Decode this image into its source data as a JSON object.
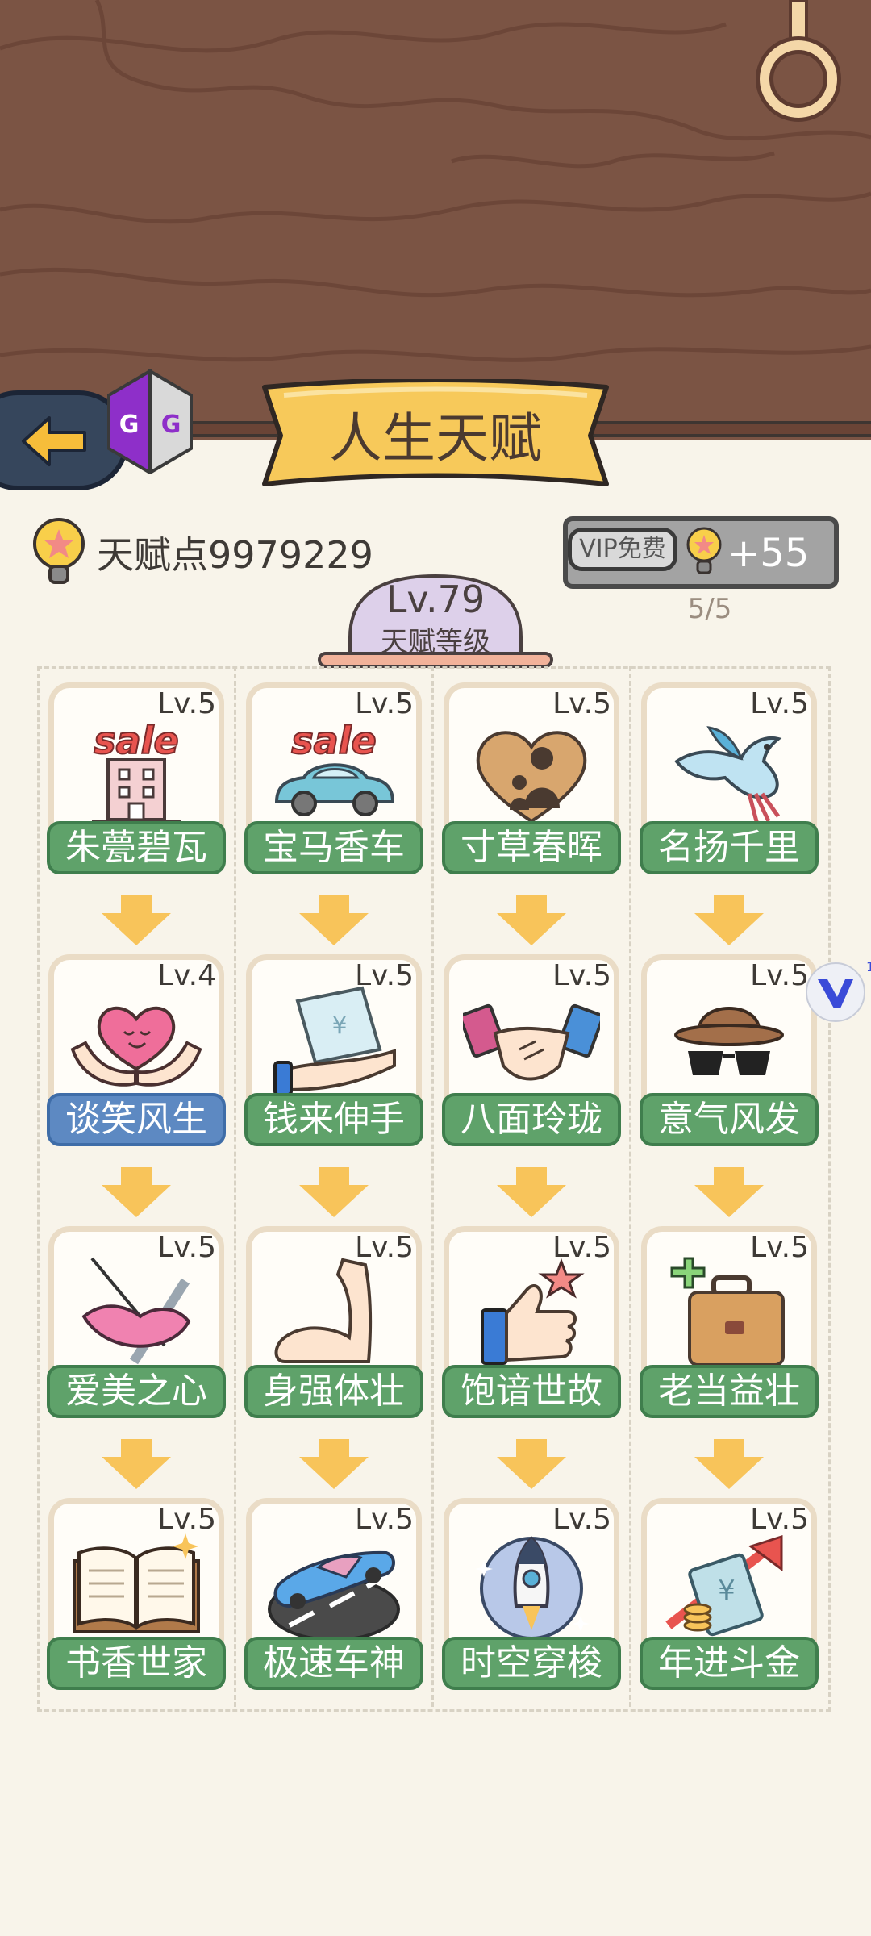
{
  "title": "人生天赋",
  "badge": "GG",
  "talent_points": "天赋点9979229",
  "vip": {
    "tag": "VIP免费",
    "bonus": "+55",
    "count": "5/5"
  },
  "level": {
    "value": "Lv.79",
    "label": "天赋等级"
  },
  "talents": [
    {
      "lv": "Lv.5",
      "name": "朱甍碧瓦",
      "icon": "building-sale-icon",
      "color": "green"
    },
    {
      "lv": "Lv.5",
      "name": "宝马香车",
      "icon": "car-sale-icon",
      "color": "green"
    },
    {
      "lv": "Lv.5",
      "name": "寸草春晖",
      "icon": "heart-family-icon",
      "color": "green"
    },
    {
      "lv": "Lv.5",
      "name": "名扬千里",
      "icon": "bird-icon",
      "color": "green"
    },
    {
      "lv": "Lv.4",
      "name": "谈笑风生",
      "icon": "heart-hands-icon",
      "color": "blue"
    },
    {
      "lv": "Lv.5",
      "name": "钱来伸手",
      "icon": "money-hand-icon",
      "color": "green"
    },
    {
      "lv": "Lv.5",
      "name": "八面玲珑",
      "icon": "handshake-icon",
      "color": "green"
    },
    {
      "lv": "Lv.5",
      "name": "意气风发",
      "icon": "hat-glasses-icon",
      "color": "green"
    },
    {
      "lv": "Lv.5",
      "name": "爱美之心",
      "icon": "lips-knife-icon",
      "color": "green"
    },
    {
      "lv": "Lv.5",
      "name": "身强体壮",
      "icon": "muscle-arm-icon",
      "color": "green"
    },
    {
      "lv": "Lv.5",
      "name": "饱谙世故",
      "icon": "thumbs-up-icon",
      "color": "green"
    },
    {
      "lv": "Lv.5",
      "name": "老当益壮",
      "icon": "briefcase-plus-icon",
      "color": "green"
    },
    {
      "lv": "Lv.5",
      "name": "书香世家",
      "icon": "open-book-icon",
      "color": "green"
    },
    {
      "lv": "Lv.5",
      "name": "极速车神",
      "icon": "race-car-icon",
      "color": "green"
    },
    {
      "lv": "Lv.5",
      "name": "时空穿梭",
      "icon": "rocket-icon",
      "color": "green"
    },
    {
      "lv": "Lv.5",
      "name": "年进斗金",
      "icon": "money-up-icon",
      "color": "green"
    }
  ]
}
